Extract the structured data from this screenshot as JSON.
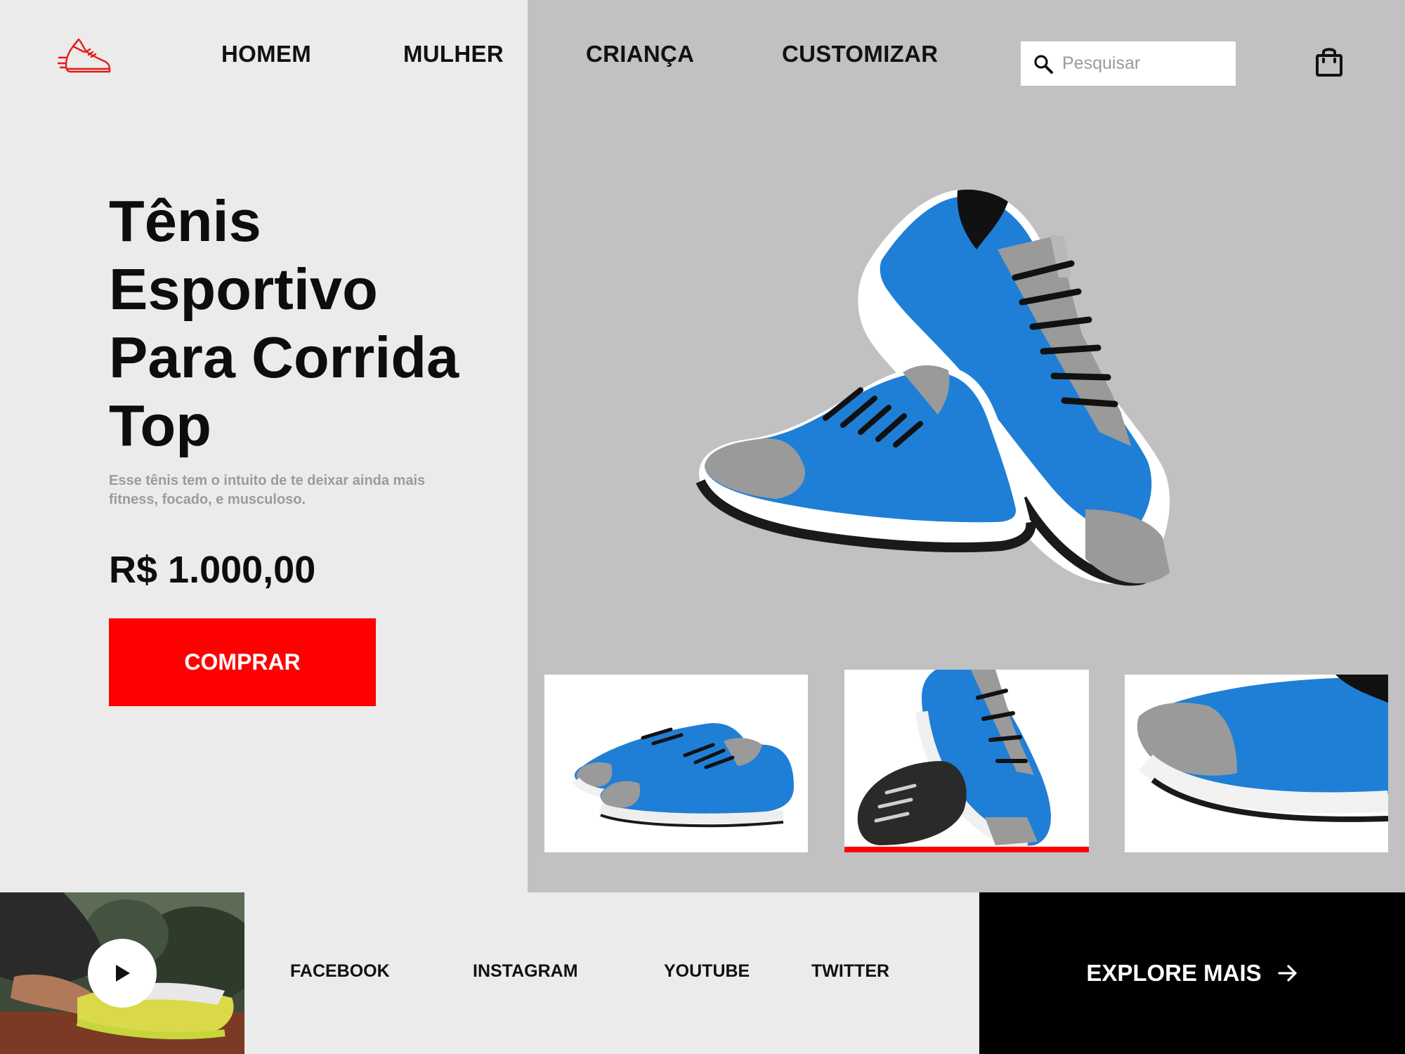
{
  "nav": {
    "items": [
      {
        "label": "HOMEM"
      },
      {
        "label": "MULHER"
      },
      {
        "label": "CRIANÇA"
      },
      {
        "label": "CUSTOMIZAR"
      }
    ],
    "search_placeholder": "Pesquisar",
    "logo_icon": "running-shoe-icon",
    "cart_icon": "shopping-bag-icon",
    "search_icon": "search-icon"
  },
  "hero": {
    "title_lines": [
      "Tênis",
      "Esportivo",
      "Para Corrida",
      "Top"
    ],
    "description": "Esse tênis tem o intuito de te deixar ainda mais fitness, focado, e musculoso.",
    "price": "R$ 1.000,00",
    "buy_label": "COMPRAR"
  },
  "gallery": {
    "selected_index": 1
  },
  "footer": {
    "social": [
      {
        "label": "FACEBOOK"
      },
      {
        "label": "INSTAGRAM"
      },
      {
        "label": "YOUTUBE"
      },
      {
        "label": "TWITTER"
      }
    ],
    "explore_label": "EXPLORE MAIS",
    "play_icon": "play-icon",
    "arrow_icon": "arrow-right-icon"
  },
  "colors": {
    "accent": "#ff0000",
    "left_bg": "#ebebeb",
    "right_bg": "#c1c1c1",
    "shoe_blue": "#1f7fd6",
    "dark": "#000000"
  }
}
